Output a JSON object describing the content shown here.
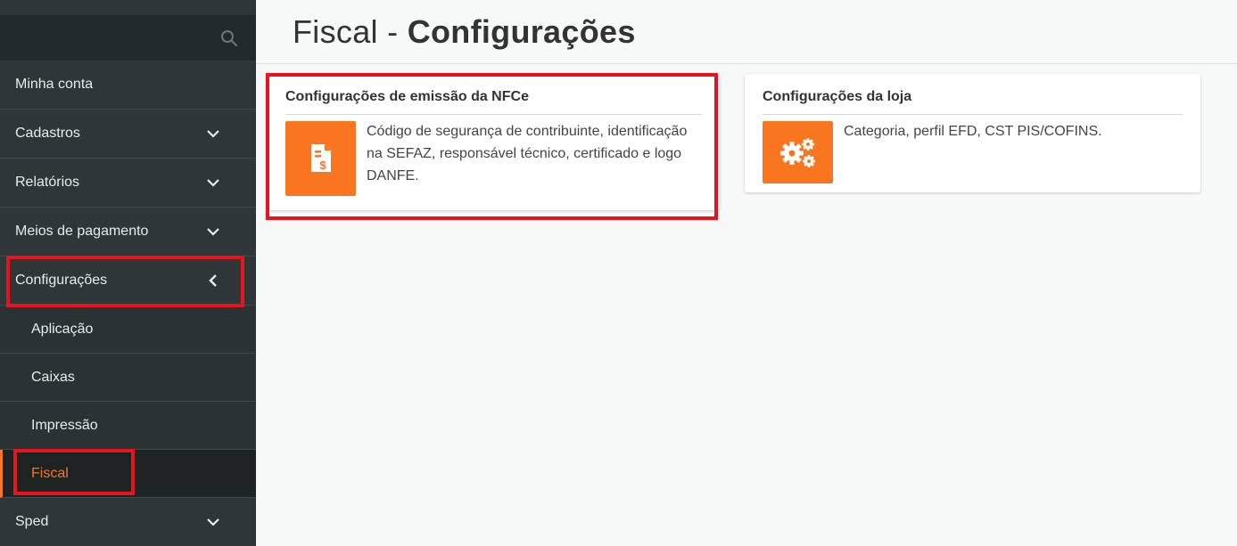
{
  "sidebar": {
    "items": [
      {
        "label": "Minha conta"
      },
      {
        "label": "Cadastros"
      },
      {
        "label": "Relatórios"
      },
      {
        "label": "Meios de pagamento"
      },
      {
        "label": "Configurações"
      },
      {
        "label": "Aplicação"
      },
      {
        "label": "Caixas"
      },
      {
        "label": "Impressão"
      },
      {
        "label": "Fiscal"
      },
      {
        "label": "Sped"
      }
    ]
  },
  "header": {
    "title_prefix": "Fiscal - ",
    "title_bold": "Configurações"
  },
  "cards": [
    {
      "title": "Configurações de emissão da NFCe",
      "description": "Código de segurança de contribuinte, identificação na SEFAZ, responsável técnico, certificado e logo DANFE.",
      "icon": "invoice-dollar-icon"
    },
    {
      "title": "Configurações da loja",
      "description": "Categoria, perfil EFD, CST PIS/COFINS.",
      "icon": "cogs-icon"
    }
  ],
  "colors": {
    "accent": "#f97520",
    "sidebar_bg": "#2e3637",
    "highlight": "#e8131b"
  }
}
